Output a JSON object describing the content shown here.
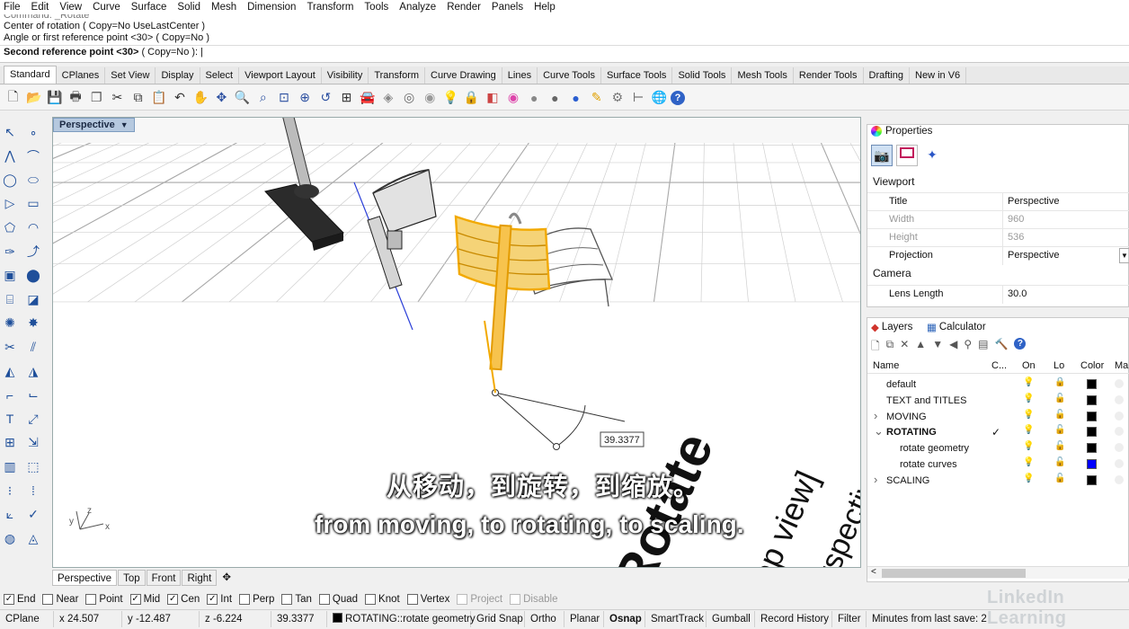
{
  "menu": [
    "File",
    "Edit",
    "View",
    "Curve",
    "Surface",
    "Solid",
    "Mesh",
    "Dimension",
    "Transform",
    "Tools",
    "Analyze",
    "Render",
    "Panels",
    "Help"
  ],
  "command_history": {
    "line0": "Command: _Rotate",
    "line1": "Center of rotation ( Copy=No  UseLastCenter )",
    "line2": "Angle or first reference point <30> ( Copy=No )",
    "prompt_bold": "Second reference point <30>",
    "prompt_options": " ( Copy=No ): |"
  },
  "tabs": [
    "Standard",
    "CPlanes",
    "Set View",
    "Display",
    "Select",
    "Viewport Layout",
    "Visibility",
    "Transform",
    "Curve Drawing",
    "Lines",
    "Curve Tools",
    "Surface Tools",
    "Solid Tools",
    "Mesh Tools",
    "Render Tools",
    "Drafting",
    "New in V6"
  ],
  "active_tab": "Standard",
  "viewport": {
    "title": "Perspective",
    "measurement": "39.3377",
    "ground_text_1": "Rotate",
    "ground_text_2": "[top view]",
    "ground_text_3": "[perspective]",
    "axes": {
      "x": "x",
      "y": "y",
      "z": "z"
    }
  },
  "view_tabs": [
    "Perspective",
    "Top",
    "Front",
    "Right"
  ],
  "properties": {
    "tab_label": "Properties",
    "section_viewport": "Viewport",
    "title_label": "Title",
    "title_value": "Perspective",
    "width_label": "Width",
    "width_value": "960",
    "height_label": "Height",
    "height_value": "536",
    "projection_label": "Projection",
    "projection_value": "Perspective",
    "section_camera": "Camera",
    "lens_label": "Lens Length",
    "lens_value": "30.0"
  },
  "layers_panel": {
    "tab_layers": "Layers",
    "tab_calculator": "Calculator",
    "col_name": "Name",
    "col_current": "C...",
    "col_on": "On",
    "col_lock": "Lo",
    "col_color": "Color",
    "col_material": "Ma",
    "rows": [
      {
        "name": "default",
        "indent": 1,
        "bold": false,
        "current": "",
        "color": "#000000",
        "lock": "closed"
      },
      {
        "name": "TEXT and TITLES",
        "indent": 1,
        "bold": false,
        "current": "",
        "color": "#000000",
        "lock": "open"
      },
      {
        "name": "MOVING",
        "indent": 1,
        "bold": false,
        "current": "",
        "color": "#000000",
        "lock": "open",
        "expander": ">"
      },
      {
        "name": "ROTATING",
        "indent": 1,
        "bold": true,
        "current": "✓",
        "color": "#000000",
        "lock": "open",
        "expander": "v"
      },
      {
        "name": "rotate geometry",
        "indent": 2,
        "bold": false,
        "current": "",
        "color": "#000000",
        "lock": "open"
      },
      {
        "name": "rotate curves",
        "indent": 2,
        "bold": false,
        "current": "",
        "color": "#0000ff",
        "lock": "open"
      },
      {
        "name": "SCALING",
        "indent": 1,
        "bold": false,
        "current": "",
        "color": "#000000",
        "lock": "open",
        "expander": ">"
      }
    ]
  },
  "osnap": [
    {
      "label": "End",
      "checked": true
    },
    {
      "label": "Near",
      "checked": false
    },
    {
      "label": "Point",
      "checked": false
    },
    {
      "label": "Mid",
      "checked": true
    },
    {
      "label": "Cen",
      "checked": true
    },
    {
      "label": "Int",
      "checked": true
    },
    {
      "label": "Perp",
      "checked": false
    },
    {
      "label": "Tan",
      "checked": false
    },
    {
      "label": "Quad",
      "checked": false
    },
    {
      "label": "Knot",
      "checked": false
    },
    {
      "label": "Vertex",
      "checked": false
    },
    {
      "label": "Project",
      "checked": false,
      "disabled": true
    },
    {
      "label": "Disable",
      "checked": false,
      "disabled": true
    }
  ],
  "status": {
    "cplane": "CPlane",
    "x": "x 24.507",
    "y": "y -12.487",
    "z": "z -6.224",
    "distance": "39.3377",
    "layer": "ROTATING::rotate geometry",
    "grid_snap": "Grid Snap",
    "ortho": "Ortho",
    "planar": "Planar",
    "osnap": "Osnap",
    "smarttrack": "SmartTrack",
    "gumball": "Gumball",
    "record_history": "Record History",
    "filter": "Filter",
    "save_info": "Minutes from last save: 2"
  },
  "subtitles": {
    "chinese": "从移动，到旋转，到缩放。",
    "english": "from moving, to rotating, to scaling."
  },
  "watermark": "LinkedIn Learning",
  "colors": {
    "selection": "#f2a900",
    "axis_blue": "#2b3fd8",
    "grid": "#b8b8b8",
    "layer_blue": "#0000ff"
  }
}
